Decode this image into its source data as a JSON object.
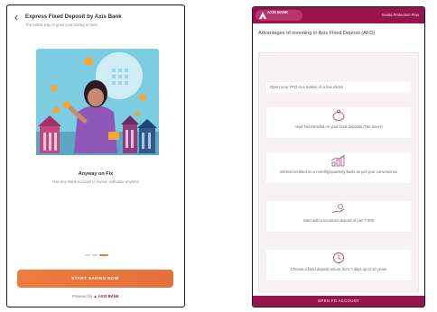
{
  "left": {
    "title": "Express Fixed Deposit by Axis Bank",
    "subtitle": "The safest way to grow your money is here",
    "card_title": "Anyway on Fix",
    "card_subtitle": "Use any Bank account to invest, withdraw anytime",
    "cta_label": "START SAVING NOW",
    "powered_prefix": "Powered by",
    "powered_brand": "AXIS BANK",
    "carousel": {
      "count": 3,
      "active": 2
    },
    "colors": {
      "accent": "#e97a3c",
      "brand": "#97144d",
      "illustration_bg": "#7ccde2"
    }
  },
  "right": {
    "brand": "AXIS BANK",
    "scheme_label": "Sevita Protection Plan",
    "heading": "Advantages of investing in Axis Fixed Deposit (AFD)",
    "banner_text": "Open your FFD in a matter of a few clicks",
    "features": [
      {
        "icon": "piggy-bank-icon",
        "text": "Avail Tax Benefits on your fixed deposits (Tax Saver)"
      },
      {
        "icon": "growth-chart-icon",
        "text": "Interest credited on a monthly/quarterly basis as per your convenience"
      },
      {
        "icon": "hand-coin-icon",
        "text": "Start with a minimum deposit of just ₹ 500"
      },
      {
        "icon": "clock-icon",
        "text": "Choose a fixed deposit tenure from 7 days up to 10 years"
      }
    ],
    "footer_label": "OPEN FD ACCOUNT",
    "colors": {
      "header": "#97144d"
    }
  }
}
